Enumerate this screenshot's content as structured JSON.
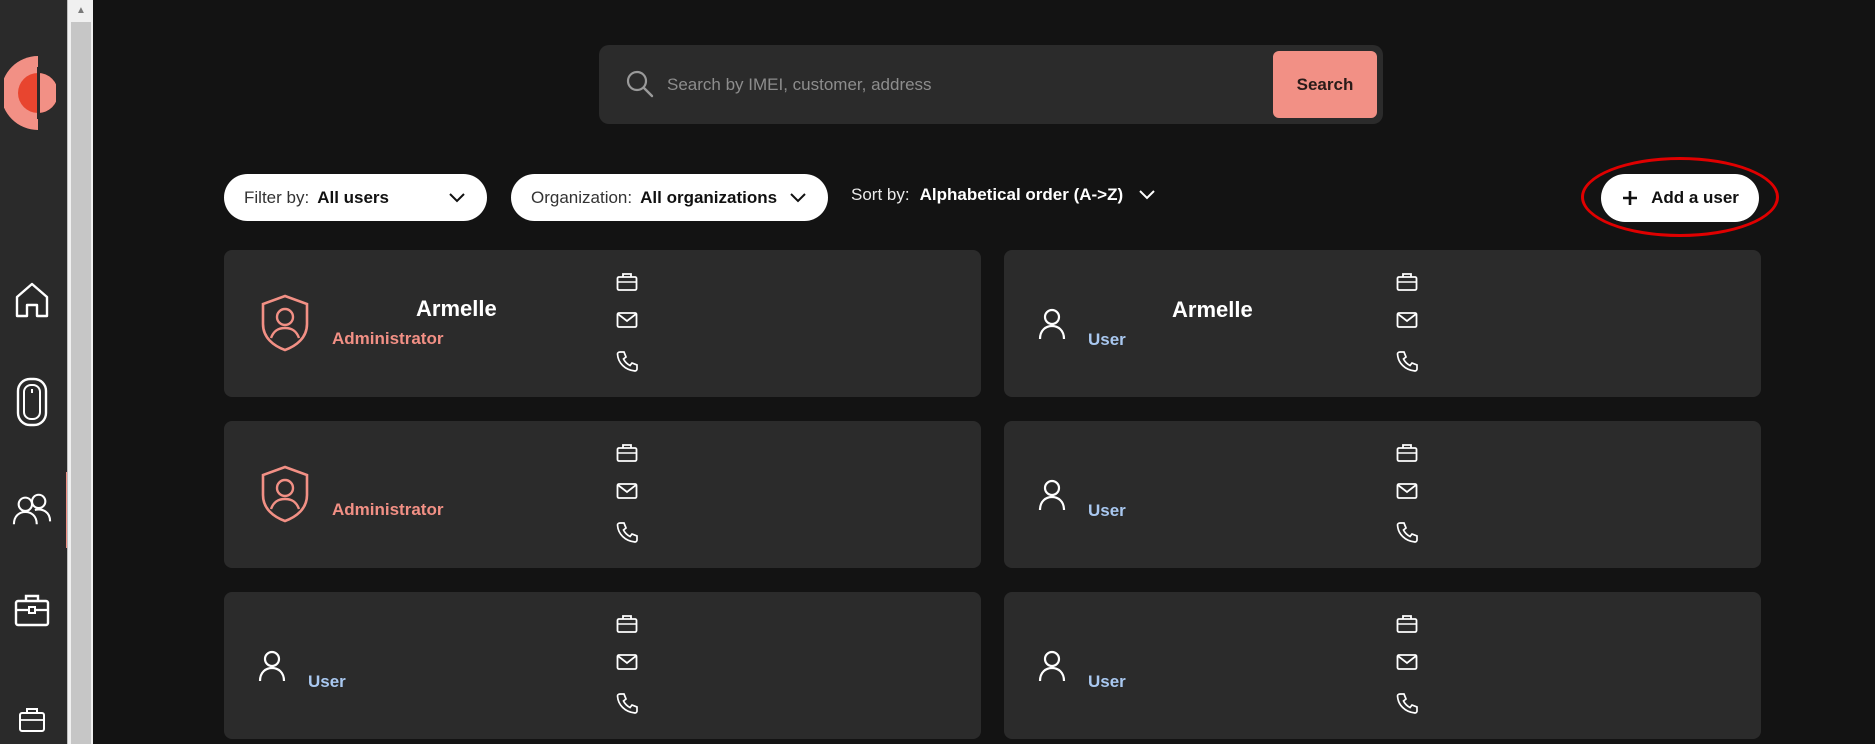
{
  "search": {
    "placeholder": "Search by IMEI, customer, address",
    "button_label": "Search"
  },
  "filters": {
    "filter_by_label": "Filter by:",
    "filter_by_value": "All users",
    "organization_label": "Organization:",
    "organization_value": "All organizations",
    "sort_label": "Sort by:",
    "sort_value": "Alphabetical order (A->Z)"
  },
  "actions": {
    "add_user_label": "Add a user"
  },
  "colors": {
    "accent": "#f29085",
    "admin_role": "#f29085",
    "user_role": "#a9c8f0",
    "card_bg": "#2b2b2b",
    "page_bg": "#131313"
  },
  "users": [
    {
      "name": "Armelle",
      "role": "Administrator",
      "icon": "shield-user-icon"
    },
    {
      "name": "Armelle",
      "role": "User",
      "icon": "user-icon"
    },
    {
      "name": "",
      "role": "Administrator",
      "icon": "shield-user-icon"
    },
    {
      "name": "",
      "role": "User",
      "icon": "user-icon"
    },
    {
      "name": "",
      "role": "User",
      "icon": "user-icon"
    },
    {
      "name": "",
      "role": "User",
      "icon": "user-icon"
    }
  ],
  "sidebar": {
    "items": [
      {
        "icon": "home-icon"
      },
      {
        "icon": "device-icon"
      },
      {
        "icon": "users-icon"
      },
      {
        "icon": "briefcase-icon"
      },
      {
        "icon": "briefcase-small-icon"
      }
    ]
  }
}
